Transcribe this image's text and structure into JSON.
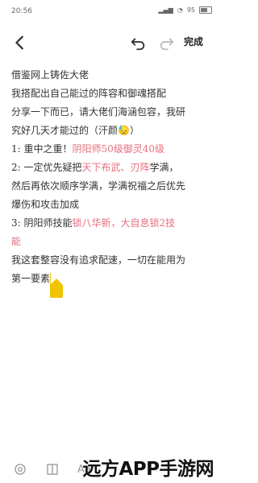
{
  "status_bar": {
    "time": "20:56",
    "battery": "95"
  },
  "toolbar": {
    "done_label": "完成"
  },
  "note": {
    "lines": [
      "借鉴网上铸佐大佬",
      "我搭配出自己能过的阵容和御魂搭配",
      "分享一下而已，请大佬们海涵包容，我研",
      "究好几天才能过的（汗颜😓）",
      "1:  重中之重！",
      "阴阳师50级御灵40级",
      "2:  一定优先疑把",
      "天下布武、刃阵",
      "学满，",
      "然后再依次顺序学满，学满祝福之后优先",
      "爆伤和攻击加成",
      "3:  阴阳师技能",
      "锁八华新，大自息锁2技",
      "能",
      "我这套整容没有追求配速，一切在能用为",
      "第一要素"
    ]
  },
  "colors": {
    "accent_pink": "#e46f7f",
    "cursor_yellow": "#f0c400"
  },
  "watermark": {
    "text": "远方APP手游网"
  },
  "icons": [
    "back-icon",
    "undo-icon",
    "redo-icon",
    "handle-icon",
    "ai-icon",
    "table-icon",
    "text-format-icon",
    "camera-icon"
  ]
}
